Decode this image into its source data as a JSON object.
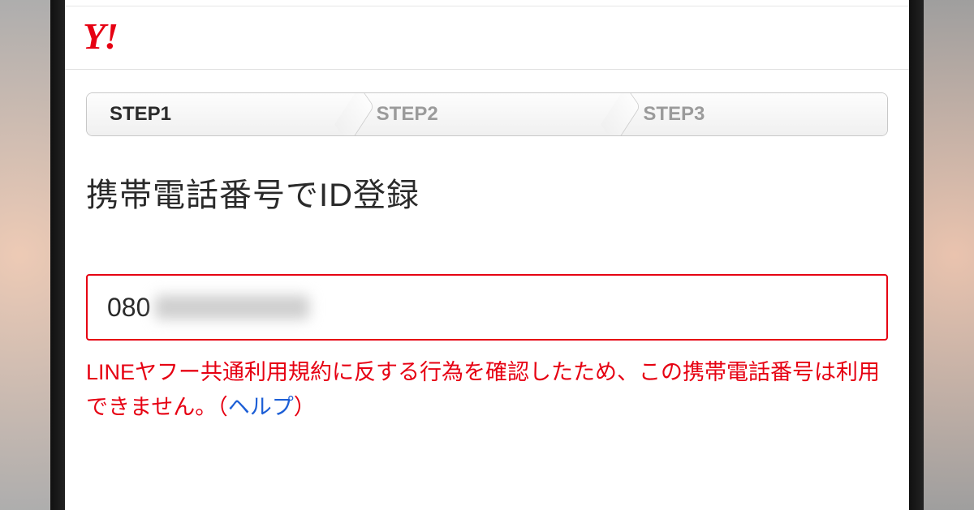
{
  "logo_text": "Y!",
  "steps": [
    {
      "label": "STEP1",
      "active": true
    },
    {
      "label": "STEP2",
      "active": false
    },
    {
      "label": "STEP3",
      "active": false
    }
  ],
  "page_title": "携帯電話番号でID登録",
  "phone_input": {
    "visible_prefix": "080"
  },
  "error": {
    "message_before_link": "LINEヤフー共通利用規約に反する行為を確認したため、この携帯電話番号は利用できません。（",
    "link_text": "ヘルプ",
    "message_after_link": "）"
  }
}
